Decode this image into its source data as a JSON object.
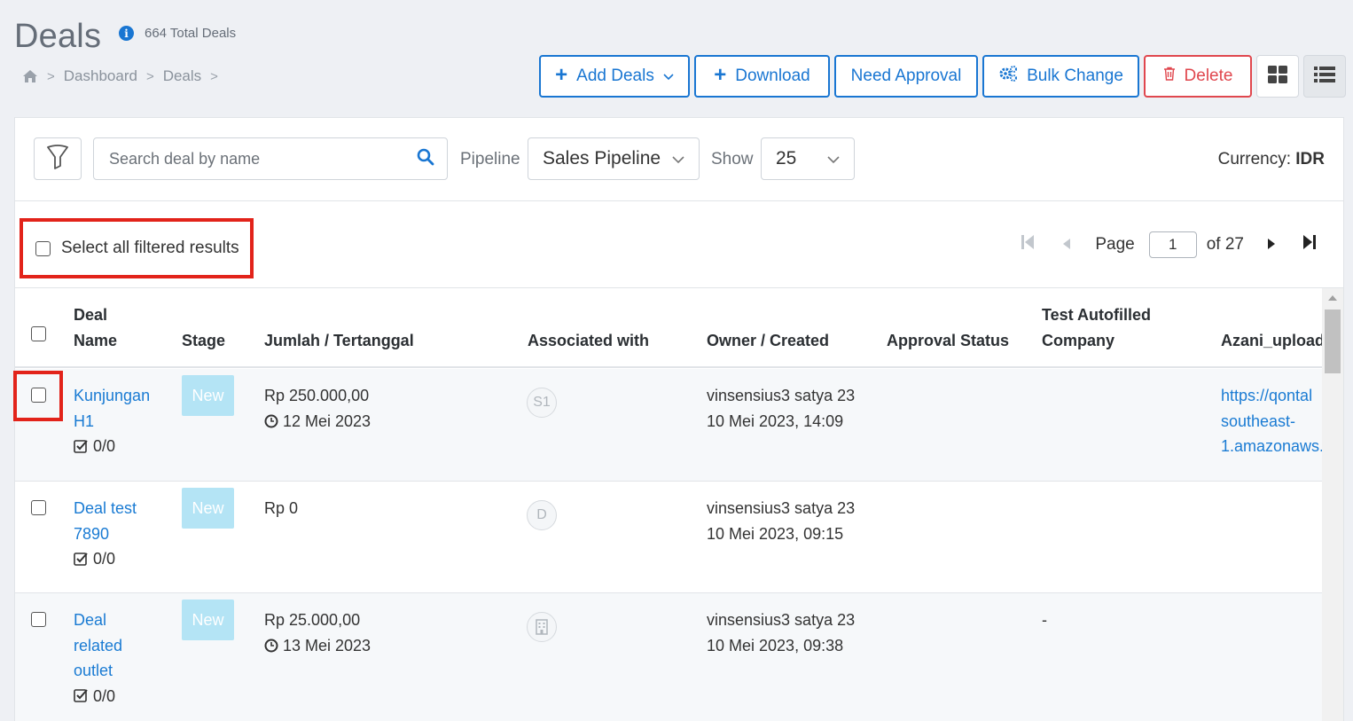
{
  "header": {
    "title": "Deals",
    "total_label": "664 Total Deals"
  },
  "breadcrumb": {
    "items": [
      "Dashboard",
      "Deals"
    ]
  },
  "toolbar": {
    "add_deals": "Add Deals",
    "download": "Download",
    "need_approval": "Need Approval",
    "bulk_change": "Bulk Change",
    "delete": "Delete"
  },
  "filters": {
    "search_placeholder": "Search deal by name",
    "pipeline_label": "Pipeline",
    "pipeline_value": "Sales Pipeline",
    "show_label": "Show",
    "show_value": "25",
    "currency_label": "Currency:",
    "currency_value": "IDR"
  },
  "select_all_label": "Select all filtered results",
  "pagination": {
    "page_label": "Page",
    "current": "1",
    "of_label": "of 27"
  },
  "table": {
    "headers": {
      "deal_name_1": "Deal",
      "deal_name_2": "Name",
      "stage": "Stage",
      "amount": "Jumlah / Tertanggal",
      "associated": "Associated with",
      "owner": "Owner / Created",
      "approval": "Approval Status",
      "autofilled_1": "Test Autofilled",
      "autofilled_2": "Company",
      "azani": "Azani_upload"
    },
    "rows": [
      {
        "name_lines": [
          "Kunjungan",
          "H1"
        ],
        "tasks": "0/0",
        "stage": "New",
        "amount": "Rp 250.000,00",
        "date": "12 Mei 2023",
        "assoc": "S1",
        "owner": "vinsensius3 satya 23",
        "created": "10 Mei 2023, 14:09",
        "company": "",
        "azani_lines": [
          "https://qontal",
          "southeast-",
          "1.amazonaws."
        ]
      },
      {
        "name_lines": [
          "Deal test",
          "7890"
        ],
        "tasks": "0/0",
        "stage": "New",
        "amount": "Rp 0",
        "date": "",
        "assoc": "D",
        "owner": "vinsensius3 satya 23",
        "created": "10 Mei 2023, 09:15",
        "company": ""
      },
      {
        "name_lines": [
          "Deal",
          "related",
          "outlet"
        ],
        "tasks": "0/0",
        "stage": "New",
        "amount": "Rp 25.000,00",
        "date": "13 Mei 2023",
        "assoc_icon": "building-icon",
        "owner": "vinsensius3 satya 23",
        "created": "10 Mei 2023, 09:38",
        "company": "-"
      }
    ]
  }
}
